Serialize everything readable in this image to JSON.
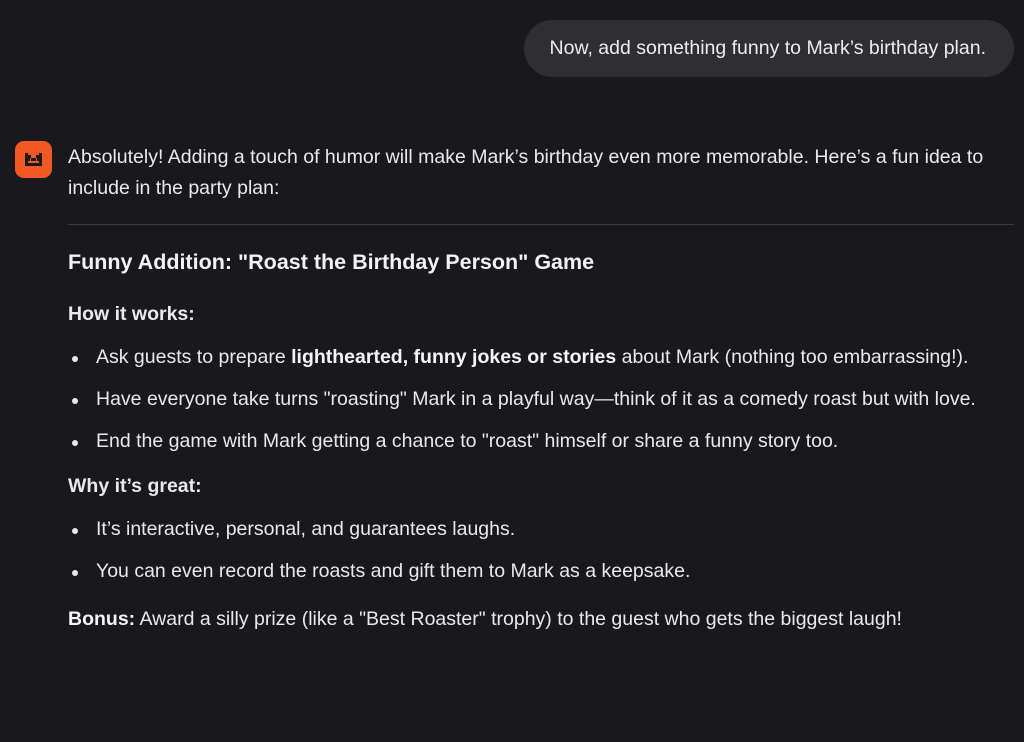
{
  "user_message": "Now, add something funny to Mark’s birthday plan.",
  "assistant": {
    "avatar_icon": "mistral-logo-icon",
    "avatar_color": "#f05a22",
    "intro": "Absolutely! Adding a touch of humor will make Mark’s birthday even more memorable. Here’s a fun idea to include in the party plan:",
    "heading": "Funny Addition: \"Roast the Birthday Person\" Game",
    "how_it_works": {
      "label": "How it works:",
      "items": [
        {
          "before": "Ask guests to prepare ",
          "bold": "lighthearted, funny jokes or stories",
          "after": " about Mark (nothing too embarrassing!)."
        },
        {
          "text": "Have everyone take turns \"roasting\" Mark in a playful way—think of it as a comedy roast but with love."
        },
        {
          "text": "End the game with Mark getting a chance to \"roast\" himself or share a funny story too."
        }
      ]
    },
    "why_great": {
      "label": "Why it’s great:",
      "items": [
        "It’s interactive, personal, and guarantees laughs.",
        "You can even record the roasts and gift them to Mark as a keepsake."
      ]
    },
    "bonus": {
      "label": "Bonus:",
      "text": " Award a silly prize (like a \"Best Roaster\" trophy) to the guest who gets the biggest laugh!"
    }
  }
}
